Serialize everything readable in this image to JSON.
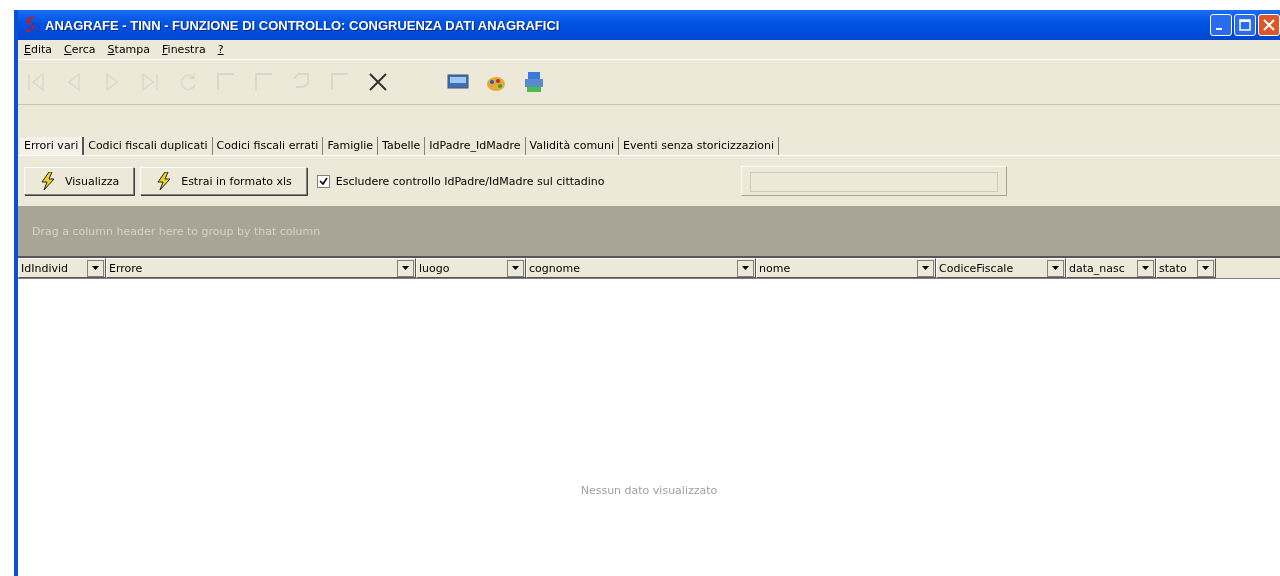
{
  "window": {
    "title": "ANAGRAFE - TINN - FUNZIONE DI CONTROLLO: CONGRUENZA DATI ANAGRAFICI"
  },
  "menu": [
    {
      "label": "Edita"
    },
    {
      "label": "Cerca"
    },
    {
      "label": "Stampa"
    },
    {
      "label": "Finestra"
    },
    {
      "label": "?"
    }
  ],
  "toolbar": [
    {
      "kind": "first",
      "disabled": true
    },
    {
      "kind": "prev",
      "disabled": true
    },
    {
      "kind": "next",
      "disabled": true
    },
    {
      "kind": "last",
      "disabled": true
    },
    {
      "kind": "refresh",
      "disabled": true
    },
    {
      "kind": "new",
      "disabled": true
    },
    {
      "kind": "edit",
      "disabled": true
    },
    {
      "kind": "undo",
      "disabled": true
    },
    {
      "kind": "save",
      "disabled": true
    },
    {
      "kind": "delete",
      "disabled": false
    },
    {
      "kind": "sep"
    },
    {
      "kind": "monitor",
      "disabled": false
    },
    {
      "kind": "palette",
      "disabled": false
    },
    {
      "kind": "printer",
      "disabled": false
    }
  ],
  "tabs": [
    {
      "label": "Errori vari",
      "selected": true
    },
    {
      "label": "Codici fiscali duplicati",
      "selected": false
    },
    {
      "label": "Codici fiscali errati",
      "selected": false
    },
    {
      "label": "Famiglie",
      "selected": false
    },
    {
      "label": "Tabelle",
      "selected": false
    },
    {
      "label": "IdPadre_IdMadre",
      "selected": false
    },
    {
      "label": "Validità comuni",
      "selected": false
    },
    {
      "label": "Eventi senza storicizzazioni",
      "selected": false
    }
  ],
  "actions": [
    {
      "label": "Visualizza"
    },
    {
      "label": "Estrai in formato xls"
    }
  ],
  "exclude_check": {
    "label": "Escludere controllo IdPadre/IdMadre sul cittadino",
    "checked": true
  },
  "group_panel": {
    "hint": "Drag a column header here to group by that column"
  },
  "table": {
    "columns": [
      "IdIndivid",
      "Errore",
      "luogo",
      "cognome",
      "nome",
      "CodiceFiscale",
      "data_nasc",
      "stato"
    ],
    "empty_text": "Nessun dato visualizzato"
  }
}
